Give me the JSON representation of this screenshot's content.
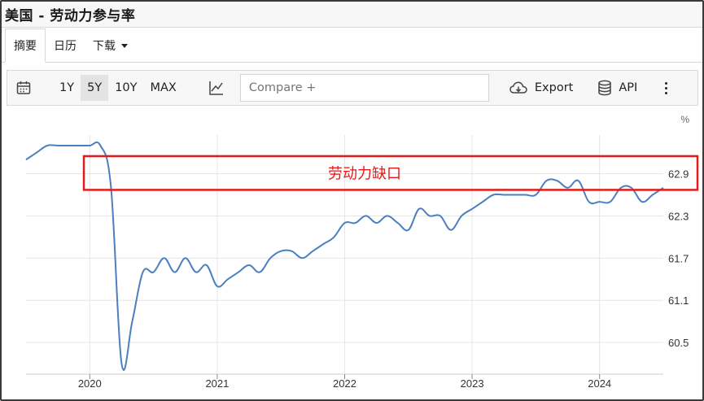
{
  "title": "美国 - 劳动力参与率",
  "tabs": [
    {
      "label": "摘要",
      "active": true
    },
    {
      "label": "日历",
      "active": false
    },
    {
      "label": "下载",
      "active": false,
      "has_dropdown": true
    }
  ],
  "toolbar": {
    "ranges": [
      "1Y",
      "5Y",
      "10Y",
      "MAX"
    ],
    "active_range": "5Y",
    "compare_placeholder": "Compare +",
    "export_label": "Export",
    "api_label": "API",
    "icons": {
      "calendar": "calendar-icon",
      "chart_type": "line-chart-icon",
      "export": "cloud-download-icon",
      "api": "database-icon",
      "more": "more-vertical-icon"
    }
  },
  "colors": {
    "line": "#4b7fbf",
    "annotation": "#e41a1a",
    "grid": "#e3e6ea"
  },
  "chart_data": {
    "type": "line",
    "title": "美国 - 劳动力参与率",
    "unit": "%",
    "xlabel": "",
    "ylabel": "",
    "x_ticks": [
      "2020",
      "2021",
      "2022",
      "2023",
      "2024"
    ],
    "y_ticks": [
      60.5,
      61.1,
      61.7,
      62.3,
      62.9
    ],
    "ylim": [
      60.05,
      63.45
    ],
    "xlim": [
      "2019-07",
      "2024-07"
    ],
    "grid": true,
    "series": [
      {
        "values": [
          {
            "x": "2019-07",
            "y": 63.1
          },
          {
            "x": "2019-08",
            "y": 63.2
          },
          {
            "x": "2019-09",
            "y": 63.3
          },
          {
            "x": "2019-10",
            "y": 63.3
          },
          {
            "x": "2019-11",
            "y": 63.3
          },
          {
            "x": "2019-12",
            "y": 63.3
          },
          {
            "x": "2020-01",
            "y": 63.3
          },
          {
            "x": "2020-02",
            "y": 63.3
          },
          {
            "x": "2020-03",
            "y": 62.7
          },
          {
            "x": "2020-04",
            "y": 60.2
          },
          {
            "x": "2020-05",
            "y": 60.8
          },
          {
            "x": "2020-06",
            "y": 61.5
          },
          {
            "x": "2020-07",
            "y": 61.5
          },
          {
            "x": "2020-08",
            "y": 61.7
          },
          {
            "x": "2020-09",
            "y": 61.5
          },
          {
            "x": "2020-10",
            "y": 61.7
          },
          {
            "x": "2020-11",
            "y": 61.5
          },
          {
            "x": "2020-12",
            "y": 61.6
          },
          {
            "x": "2021-01",
            "y": 61.3
          },
          {
            "x": "2021-02",
            "y": 61.4
          },
          {
            "x": "2021-03",
            "y": 61.5
          },
          {
            "x": "2021-04",
            "y": 61.6
          },
          {
            "x": "2021-05",
            "y": 61.5
          },
          {
            "x": "2021-06",
            "y": 61.7
          },
          {
            "x": "2021-07",
            "y": 61.8
          },
          {
            "x": "2021-08",
            "y": 61.8
          },
          {
            "x": "2021-09",
            "y": 61.7
          },
          {
            "x": "2021-10",
            "y": 61.8
          },
          {
            "x": "2021-11",
            "y": 61.9
          },
          {
            "x": "2021-12",
            "y": 62.0
          },
          {
            "x": "2022-01",
            "y": 62.2
          },
          {
            "x": "2022-02",
            "y": 62.2
          },
          {
            "x": "2022-03",
            "y": 62.3
          },
          {
            "x": "2022-04",
            "y": 62.2
          },
          {
            "x": "2022-05",
            "y": 62.3
          },
          {
            "x": "2022-06",
            "y": 62.2
          },
          {
            "x": "2022-07",
            "y": 62.1
          },
          {
            "x": "2022-08",
            "y": 62.4
          },
          {
            "x": "2022-09",
            "y": 62.3
          },
          {
            "x": "2022-10",
            "y": 62.3
          },
          {
            "x": "2022-11",
            "y": 62.1
          },
          {
            "x": "2022-12",
            "y": 62.3
          },
          {
            "x": "2023-01",
            "y": 62.4
          },
          {
            "x": "2023-02",
            "y": 62.5
          },
          {
            "x": "2023-03",
            "y": 62.6
          },
          {
            "x": "2023-04",
            "y": 62.6
          },
          {
            "x": "2023-05",
            "y": 62.6
          },
          {
            "x": "2023-06",
            "y": 62.6
          },
          {
            "x": "2023-07",
            "y": 62.6
          },
          {
            "x": "2023-08",
            "y": 62.8
          },
          {
            "x": "2023-09",
            "y": 62.8
          },
          {
            "x": "2023-10",
            "y": 62.7
          },
          {
            "x": "2023-11",
            "y": 62.8
          },
          {
            "x": "2023-12",
            "y": 62.5
          },
          {
            "x": "2024-01",
            "y": 62.5
          },
          {
            "x": "2024-02",
            "y": 62.5
          },
          {
            "x": "2024-03",
            "y": 62.7
          },
          {
            "x": "2024-04",
            "y": 62.7
          },
          {
            "x": "2024-05",
            "y": 62.5
          },
          {
            "x": "2024-06",
            "y": 62.6
          },
          {
            "x": "2024-07",
            "y": 62.7
          }
        ]
      }
    ],
    "annotations": [
      {
        "text": "劳动力缺口",
        "y_range": [
          62.67,
          63.15
        ],
        "x_range": [
          "2020-01",
          "2024-07"
        ]
      }
    ]
  }
}
